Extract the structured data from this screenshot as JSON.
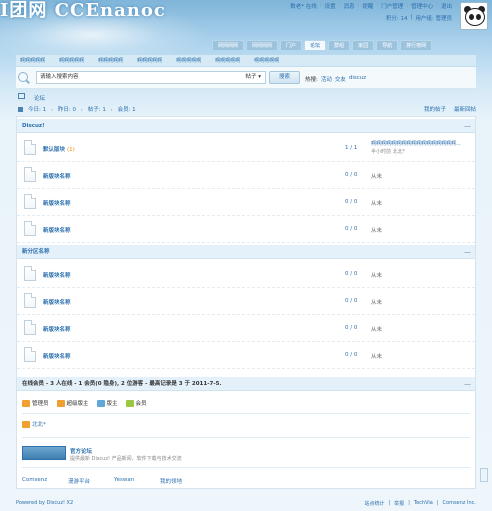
{
  "header": {
    "logo_text": "I团网 CCEnanoc",
    "toplinks": [
      "数老* 在线",
      "设置",
      "消息",
      "提醒",
      "门户管理",
      "管理中心",
      "退出"
    ],
    "user_line": [
      "积分: 14",
      "用户组: 管理员"
    ]
  },
  "nav": {
    "tabs": [
      {
        "label": "网网网网"
      },
      {
        "label": "网网网网"
      },
      {
        "label": "门户"
      },
      {
        "label": "论坛"
      },
      {
        "label": "群组"
      },
      {
        "label": "家园"
      },
      {
        "label": "导航"
      },
      {
        "label": "排行榜网"
      }
    ],
    "active_index": 3,
    "sub_items": [
      "啊啊啊啊啊",
      "啊啊啊啊啊",
      "啊啊啊啊啊",
      "啊啊啊啊啊",
      "啊啊啊啊啊",
      "啊啊啊啊啊",
      "啊啊啊啊啊"
    ]
  },
  "search": {
    "value": "请输入搜索内容",
    "type": "帖子",
    "button": "搜索",
    "hot_label": "热搜:",
    "hot_items": [
      "活动",
      "交友",
      "discuz"
    ]
  },
  "breadcrumb": "论坛",
  "stats": {
    "today": "今日: 1",
    "yesterday": "昨日: 0",
    "posts": "帖子: 1",
    "members": "会员: 1",
    "link_my_posts": "我的帖子",
    "link_new": "最新回帖"
  },
  "categories": [
    {
      "name": "Discuz!",
      "forums": [
        {
          "name": "默认版块",
          "today": "(1)",
          "count": "1 / 1",
          "last_title": "啊啊啊啊啊啊啊啊啊啊啊啊啊啊啊啊啊...",
          "last_meta": "半小时前 北北*"
        },
        {
          "name": "新版块名称",
          "today": "",
          "count": "0 / 0",
          "last": "从未"
        },
        {
          "name": "新版块名称",
          "today": "",
          "count": "0 / 0",
          "last": "从未"
        },
        {
          "name": "新版块名称",
          "today": "",
          "count": "0 / 0",
          "last": "从未"
        }
      ]
    },
    {
      "name": "新分区名称",
      "forums": [
        {
          "name": "新版块名称",
          "today": "",
          "count": "0 / 0",
          "last": "从未"
        },
        {
          "name": "新版块名称",
          "today": "",
          "count": "0 / 0",
          "last": "从未"
        },
        {
          "name": "新版块名称",
          "today": "",
          "count": "0 / 0",
          "last": "从未"
        },
        {
          "name": "新版块名称",
          "today": "",
          "count": "0 / 0",
          "last": "从未"
        }
      ]
    }
  ],
  "online": {
    "heading": "在线会员 - 3 人在线 - 1 会员(0 隐身), 2 位游客 - 最高记录是 3 于 2011-7-5.",
    "legend": [
      {
        "label": "管理员",
        "color": "#f0a030"
      },
      {
        "label": "超级版主",
        "color": "#f0a030"
      },
      {
        "label": "版主",
        "color": "#5fa8d8"
      },
      {
        "label": "会员",
        "color": "#9ac840"
      }
    ],
    "user": "北北*"
  },
  "friend": {
    "title": "官方论坛",
    "desc": "提供最新 Discuz! 产品新闻、软件下载与技术交流"
  },
  "links": [
    "Comsenz",
    "漫游平台",
    "Yeswan",
    "我的领地"
  ],
  "footer": {
    "left": "Powered by Discuz! X2",
    "right": [
      "站点统计",
      "举报",
      "TechVia",
      "Comsenz Inc."
    ]
  }
}
